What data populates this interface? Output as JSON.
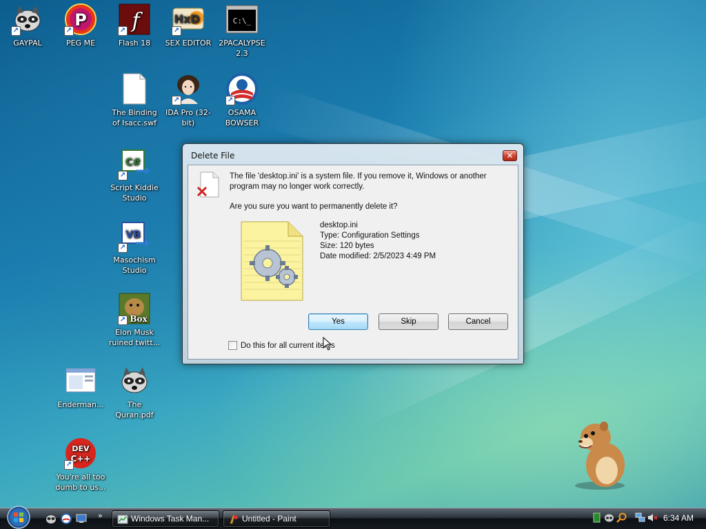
{
  "desktop": {
    "icons": [
      {
        "label": "GAYPAL"
      },
      {
        "label": "PEG ME",
        "glyph": "P"
      },
      {
        "label": "Flash 18",
        "glyph": "f"
      },
      {
        "label": "SEX EDITOR",
        "glyph": "HxD"
      },
      {
        "label": "2PACALYPSE 2.3",
        "glyph": "C:\\_"
      },
      {
        "label": "The Binding of Isacc.swf"
      },
      {
        "label": "IDA Pro (32-bit)"
      },
      {
        "label": "OSAMA BOWSER"
      },
      {
        "label": "Script Kiddie Studio",
        "glyph": "C#"
      },
      {
        "label": "Masochism Studio",
        "glyph": "VB"
      },
      {
        "label": "Elon Musk ruined twitt...",
        "glyph": "Box"
      },
      {
        "label": "Enderman..."
      },
      {
        "label": "The Quran.pdf"
      },
      {
        "label": "You're all too dumb to us...",
        "glyph": "DEV",
        "glyph2": "C++"
      }
    ]
  },
  "dialog": {
    "title": "Delete File",
    "close_glyph": "✕",
    "message": "The file 'desktop.ini' is a system file. If you remove it, Windows or another program may no longer work correctly.",
    "question": "Are you sure you want to permanently delete it?",
    "file": {
      "name": "desktop.ini",
      "type": "Type: Configuration Settings",
      "size": "Size: 120 bytes",
      "modified": "Date modified: 2/5/2023 4:49 PM"
    },
    "buttons": {
      "yes": "Yes",
      "skip": "Skip",
      "cancel": "Cancel"
    },
    "checkbox_label": "Do this for all current items"
  },
  "taskbar": {
    "chevron": "»",
    "tasks": [
      {
        "label": "Windows Task Man..."
      },
      {
        "label": "Untitled - Paint"
      }
    ],
    "clock": "6:34 AM"
  },
  "colors": {
    "accent": "#3c7fb1",
    "close": "#c8402a"
  }
}
